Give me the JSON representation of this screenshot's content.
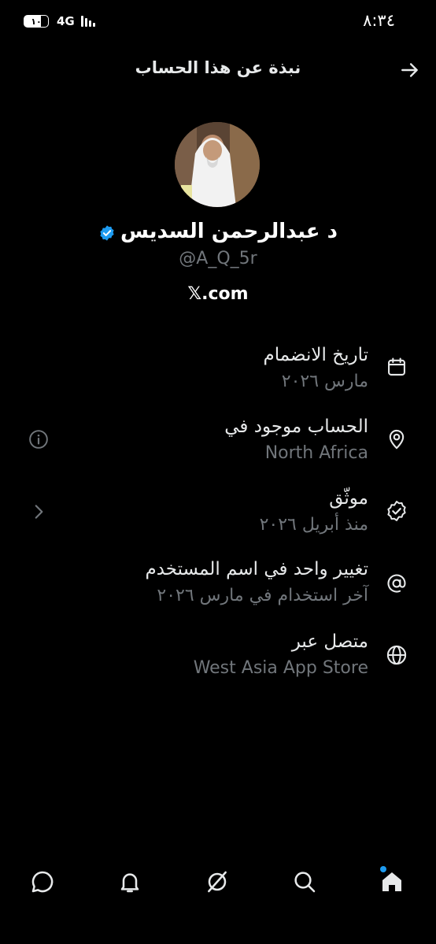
{
  "status_bar": {
    "time": "٨:٣٤",
    "battery": "١٠",
    "network": "4G"
  },
  "header": {
    "title": "نبذة عن هذا الحساب",
    "back_icon": "arrow-right-icon"
  },
  "profile": {
    "display_name": "د عبدالرحمن السديس",
    "handle": "@A_Q_5r",
    "domain_label": ".com",
    "domain_logo": "𝕏",
    "verified_color": "#1d9bf0"
  },
  "info_rows": [
    {
      "icon": "calendar-icon",
      "title": "تاريخ الانضمام",
      "subtitle": "مارس ٢٠٢٦"
    },
    {
      "icon": "location-pin-icon",
      "title": "الحساب موجود في",
      "subtitle": "North Africa",
      "side_icon": "info-icon"
    },
    {
      "icon": "verified-badge-icon",
      "title": "موثّق",
      "subtitle": "منذ أبريل ٢٠٢٦",
      "side_icon": "chevron-right-icon"
    },
    {
      "icon": "at-sign-icon",
      "title": "تغيير واحد في اسم المستخدم",
      "subtitle": "آخر استخدام في مارس ٢٠٢٦"
    },
    {
      "icon": "globe-icon",
      "title": "متصل عبر",
      "subtitle": "West Asia App Store"
    }
  ],
  "bottom_nav": {
    "items": [
      "chat-icon",
      "bell-icon",
      "grok-icon",
      "search-icon",
      "home-icon"
    ],
    "accent": "#1d9bf0"
  },
  "colors": {
    "background": "#000000",
    "primary_text": "#e7e9ea",
    "secondary_text": "#71767b"
  }
}
